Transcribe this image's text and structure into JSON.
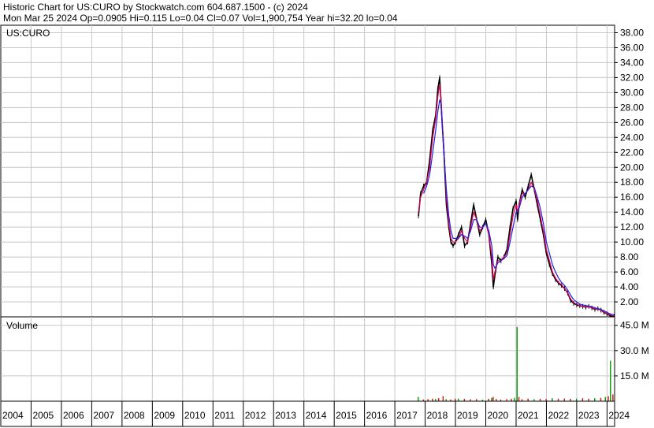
{
  "header": {
    "line1": "Historic Chart for US:CURO by Stockwatch.com 604.687.1500 - (c) 2024",
    "line2": "Mon Mar 25 2024   Op=0.0905   Hi=0.115   Lo=0.04   Cl=0.07   Vol=1,900,754   Year hi=32.20   lo=0.04"
  },
  "colors": {
    "price": "#000000",
    "ma_short": "#e0005a",
    "ma_long": "#2020e0",
    "grid": "#c8c8c8",
    "volume_green": "#10a010",
    "volume_red": "#d02020"
  },
  "chart_data": [
    {
      "type": "line",
      "title": "US:CURO",
      "ylim": [
        0,
        39
      ],
      "yticks": [
        "38.00",
        "36.00",
        "34.00",
        "32.00",
        "30.00",
        "28.00",
        "26.00",
        "24.00",
        "22.00",
        "20.00",
        "18.00",
        "16.00",
        "14.00",
        "12.00",
        "10.00",
        "8.00",
        "6.00",
        "4.00",
        "2.00"
      ],
      "ytick_values": [
        38,
        36,
        34,
        32,
        30,
        28,
        26,
        24,
        22,
        20,
        18,
        16,
        14,
        12,
        10,
        8,
        6,
        4,
        2
      ],
      "x": [
        2017.78,
        2017.85,
        2017.95,
        2018.05,
        2018.15,
        2018.25,
        2018.35,
        2018.42,
        2018.48,
        2018.52,
        2018.56,
        2018.62,
        2018.7,
        2018.78,
        2018.85,
        2018.92,
        2019.0,
        2019.1,
        2019.2,
        2019.3,
        2019.4,
        2019.5,
        2019.6,
        2019.7,
        2019.8,
        2019.9,
        2020.0,
        2020.1,
        2020.2,
        2020.25,
        2020.3,
        2020.4,
        2020.5,
        2020.6,
        2020.7,
        2020.8,
        2020.9,
        2021.0,
        2021.05,
        2021.1,
        2021.2,
        2021.3,
        2021.4,
        2021.5,
        2021.6,
        2021.7,
        2021.8,
        2021.9,
        2022.0,
        2022.1,
        2022.2,
        2022.3,
        2022.4,
        2022.5,
        2022.6,
        2022.7,
        2022.8,
        2022.9,
        2023.0,
        2023.1,
        2023.2,
        2023.3,
        2023.4,
        2023.5,
        2023.6,
        2023.7,
        2023.8,
        2023.9,
        2024.0,
        2024.1,
        2024.23
      ],
      "series": [
        {
          "role": "price",
          "values": [
            13.5,
            16.5,
            17.5,
            18,
            21,
            25,
            27,
            30.5,
            32,
            29,
            26,
            22,
            15,
            12,
            10,
            9.5,
            10,
            11,
            12,
            9.5,
            10,
            12.5,
            15,
            13,
            11,
            12,
            13,
            11,
            7,
            4,
            5.5,
            8,
            7.5,
            8,
            9,
            12,
            14.5,
            15.5,
            13,
            15,
            17,
            16,
            17.5,
            19,
            17,
            15,
            13,
            11,
            8.5,
            7,
            5.8,
            5,
            4.5,
            4.2,
            3.8,
            3.2,
            2.2,
            1.8,
            1.6,
            1.5,
            1.4,
            1.3,
            1.4,
            1.2,
            1.0,
            1.1,
            0.9,
            0.6,
            0.4,
            0.15,
            0.07
          ]
        },
        {
          "role": "ma_short",
          "values": [
            14,
            16,
            17,
            18,
            20,
            24,
            26.5,
            29.5,
            31,
            29.5,
            26.5,
            22.5,
            16,
            12.5,
            10.5,
            10,
            10,
            10.5,
            11.5,
            10.5,
            10,
            12,
            14,
            13,
            11.5,
            12,
            12.5,
            11,
            8,
            5,
            6,
            7.5,
            7.5,
            8,
            8.5,
            11,
            13.5,
            15,
            14,
            15,
            16.5,
            16.5,
            17,
            18,
            17,
            15.5,
            13.5,
            11.5,
            9,
            7.5,
            6,
            5.2,
            4.6,
            4.3,
            3.8,
            3.2,
            2.4,
            1.9,
            1.7,
            1.5,
            1.4,
            1.35,
            1.35,
            1.2,
            1.05,
            1.05,
            0.9,
            0.65,
            0.45,
            0.25,
            0.12
          ]
        },
        {
          "role": "ma_long",
          "values": [
            null,
            null,
            16.5,
            17.5,
            19,
            22,
            25,
            27.5,
            29,
            28.5,
            26,
            22,
            17,
            13.5,
            11.5,
            10.5,
            10.5,
            10.5,
            11,
            10.8,
            10.5,
            11.5,
            13,
            13,
            12,
            12,
            12.5,
            11.5,
            9.5,
            7,
            6.5,
            7.2,
            7.5,
            7.8,
            8.2,
            10,
            12,
            14,
            14,
            14.5,
            16,
            16.5,
            17,
            17.5,
            17.3,
            16,
            14.5,
            12.5,
            10,
            8.5,
            7,
            6,
            5.2,
            4.6,
            4.2,
            3.6,
            2.9,
            2.3,
            2,
            1.7,
            1.6,
            1.5,
            1.45,
            1.35,
            1.2,
            1.1,
            1.0,
            0.8,
            0.6,
            0.4,
            0.25
          ]
        }
      ]
    },
    {
      "type": "bar",
      "title": "Volume",
      "ylim": [
        0,
        50
      ],
      "yticks": [
        "45.0 M",
        "30.0 M",
        "15.0 M"
      ],
      "ytick_values": [
        45,
        30,
        15
      ],
      "bars": [
        {
          "x": 2017.78,
          "value": 2.5,
          "color": "green"
        },
        {
          "x": 2017.95,
          "value": 1.0,
          "color": "red"
        },
        {
          "x": 2018.1,
          "value": 1.2,
          "color": "red"
        },
        {
          "x": 2018.25,
          "value": 1.5,
          "color": "red"
        },
        {
          "x": 2018.35,
          "value": 1.3,
          "color": "green"
        },
        {
          "x": 2018.45,
          "value": 1.8,
          "color": "red"
        },
        {
          "x": 2018.6,
          "value": 3.0,
          "color": "red"
        },
        {
          "x": 2018.7,
          "value": 1.2,
          "color": "green"
        },
        {
          "x": 2018.85,
          "value": 1.0,
          "color": "red"
        },
        {
          "x": 2019.0,
          "value": 1.5,
          "color": "red"
        },
        {
          "x": 2019.1,
          "value": 1.6,
          "color": "green"
        },
        {
          "x": 2019.3,
          "value": 1.4,
          "color": "red"
        },
        {
          "x": 2019.5,
          "value": 1.1,
          "color": "red"
        },
        {
          "x": 2019.7,
          "value": 1.2,
          "color": "red"
        },
        {
          "x": 2019.9,
          "value": 0.9,
          "color": "green"
        },
        {
          "x": 2020.1,
          "value": 1.5,
          "color": "red"
        },
        {
          "x": 2020.2,
          "value": 2.0,
          "color": "green"
        },
        {
          "x": 2020.25,
          "value": 2.5,
          "color": "red"
        },
        {
          "x": 2020.35,
          "value": 1.3,
          "color": "red"
        },
        {
          "x": 2020.5,
          "value": 1.0,
          "color": "red"
        },
        {
          "x": 2020.7,
          "value": 1.2,
          "color": "red"
        },
        {
          "x": 2020.85,
          "value": 1.5,
          "color": "red"
        },
        {
          "x": 2020.95,
          "value": 2.0,
          "color": "green"
        },
        {
          "x": 2021.04,
          "value": 44.0,
          "color": "green"
        },
        {
          "x": 2021.1,
          "value": 2.5,
          "color": "red"
        },
        {
          "x": 2021.2,
          "value": 1.2,
          "color": "red"
        },
        {
          "x": 2021.4,
          "value": 1.5,
          "color": "red"
        },
        {
          "x": 2021.6,
          "value": 1.2,
          "color": "green"
        },
        {
          "x": 2021.8,
          "value": 1.4,
          "color": "red"
        },
        {
          "x": 2022.0,
          "value": 1.3,
          "color": "red"
        },
        {
          "x": 2022.2,
          "value": 1.8,
          "color": "green"
        },
        {
          "x": 2022.4,
          "value": 1.5,
          "color": "red"
        },
        {
          "x": 2022.6,
          "value": 1.6,
          "color": "red"
        },
        {
          "x": 2022.8,
          "value": 1.4,
          "color": "red"
        },
        {
          "x": 2023.0,
          "value": 1.6,
          "color": "green"
        },
        {
          "x": 2023.2,
          "value": 1.8,
          "color": "red"
        },
        {
          "x": 2023.4,
          "value": 1.5,
          "color": "red"
        },
        {
          "x": 2023.6,
          "value": 1.8,
          "color": "green"
        },
        {
          "x": 2023.8,
          "value": 2.0,
          "color": "red"
        },
        {
          "x": 2023.95,
          "value": 2.5,
          "color": "green"
        },
        {
          "x": 2024.05,
          "value": 3.0,
          "color": "red"
        },
        {
          "x": 2024.12,
          "value": 24.0,
          "color": "green"
        },
        {
          "x": 2024.2,
          "value": 4.0,
          "color": "red"
        }
      ]
    }
  ],
  "x_axis": {
    "labels": [
      "2004",
      "2005",
      "2006",
      "2007",
      "2008",
      "2009",
      "2010",
      "2011",
      "2012",
      "2013",
      "2014",
      "2015",
      "2016",
      "2017",
      "2018",
      "2019",
      "2020",
      "2021",
      "2022",
      "2023",
      "2024"
    ],
    "start": 2004,
    "end": 2024.25
  }
}
